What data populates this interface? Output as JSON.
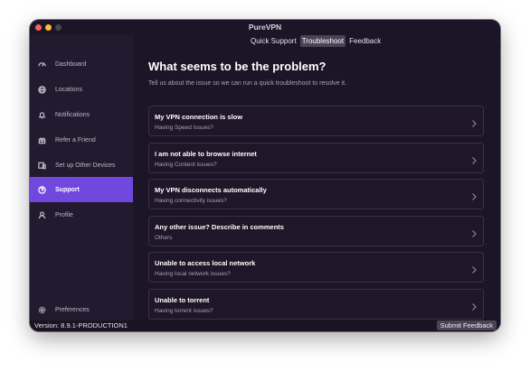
{
  "app": {
    "title": "PureVPN"
  },
  "tabs": [
    {
      "label": "Quick Support",
      "active": false
    },
    {
      "label": "Troubleshoot",
      "active": true
    },
    {
      "label": "Feedback",
      "active": false
    }
  ],
  "sidebar": {
    "items": [
      {
        "label": "Dashboard",
        "icon": "dashboard-icon"
      },
      {
        "label": "Locations",
        "icon": "globe-icon"
      },
      {
        "label": "Notifications",
        "icon": "bell-icon"
      },
      {
        "label": "Refer a Friend",
        "icon": "gift-icon"
      },
      {
        "label": "Set up Other Devices",
        "icon": "devices-icon"
      },
      {
        "label": "Support",
        "icon": "question-icon",
        "active": true
      },
      {
        "label": "Profile",
        "icon": "user-icon"
      }
    ],
    "preferences": {
      "label": "Preferences",
      "icon": "gear-icon"
    }
  },
  "main": {
    "heading": "What seems to be the problem?",
    "subheading": "Tell us about the issue so we can run a quick troubleshoot to resolve it.",
    "issues": [
      {
        "title": "My VPN connection is slow",
        "sub": "Having Speed Issues?"
      },
      {
        "title": "I am not able to browse internet",
        "sub": "Having Content issues?"
      },
      {
        "title": "My VPN disconnects automatically",
        "sub": "Having connectivity issues?"
      },
      {
        "title": "Any other issue? Describe in comments",
        "sub": "Others"
      },
      {
        "title": "Unable to access local network",
        "sub": "Having local network issues?"
      },
      {
        "title": "Unable to torrent",
        "sub": "Having torrent issues?"
      }
    ]
  },
  "footer": {
    "version": "Version: 8.9.1-PRODUCTION1",
    "submit_label": "Submit Feedback"
  },
  "colors": {
    "accent": "#7148dd",
    "background": "#1c1427",
    "sidebar": "#221a2e"
  }
}
